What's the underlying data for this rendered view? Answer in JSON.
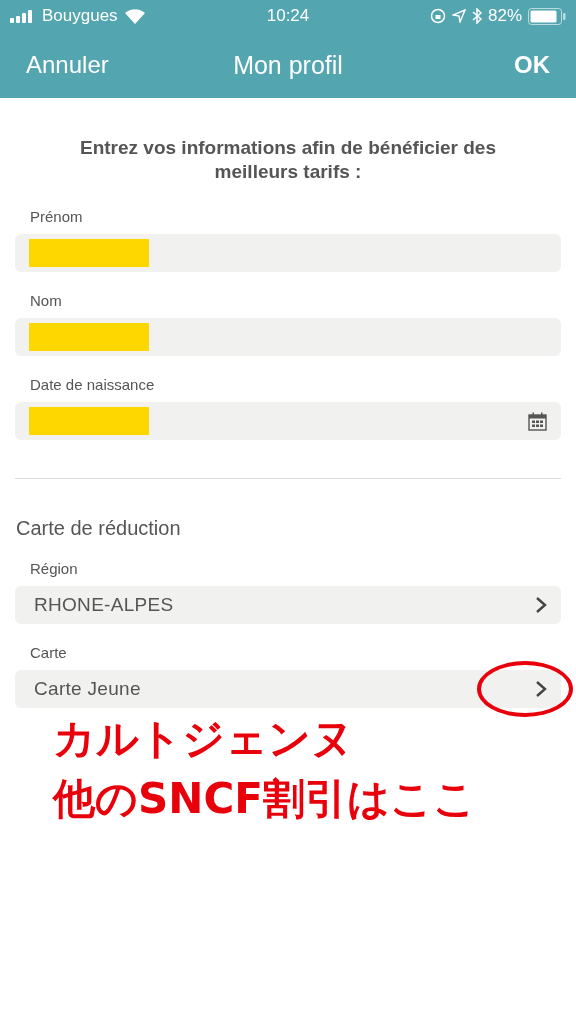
{
  "status_bar": {
    "carrier": "Bouygues",
    "time": "10:24",
    "battery": "82%"
  },
  "nav": {
    "cancel": "Annuler",
    "title": "Mon profil",
    "ok": "OK"
  },
  "intro": "Entrez vos informations afin de bénéficier des meilleurs tarifs :",
  "identity_fields": [
    {
      "label": "Prénom",
      "redacted": true,
      "kind": "text"
    },
    {
      "label": "Nom",
      "redacted": true,
      "kind": "text"
    },
    {
      "label": "Date de naissance",
      "redacted": true,
      "kind": "date"
    }
  ],
  "section_title": "Carte de réduction",
  "select_fields": [
    {
      "label": "Région",
      "value": "RHONE-ALPES",
      "circled": false
    },
    {
      "label": "Carte",
      "value": "Carte Jeune",
      "circled": true
    }
  ],
  "annotation": [
    "カルトジェンヌ",
    "他のSNCF割引はここ"
  ]
}
